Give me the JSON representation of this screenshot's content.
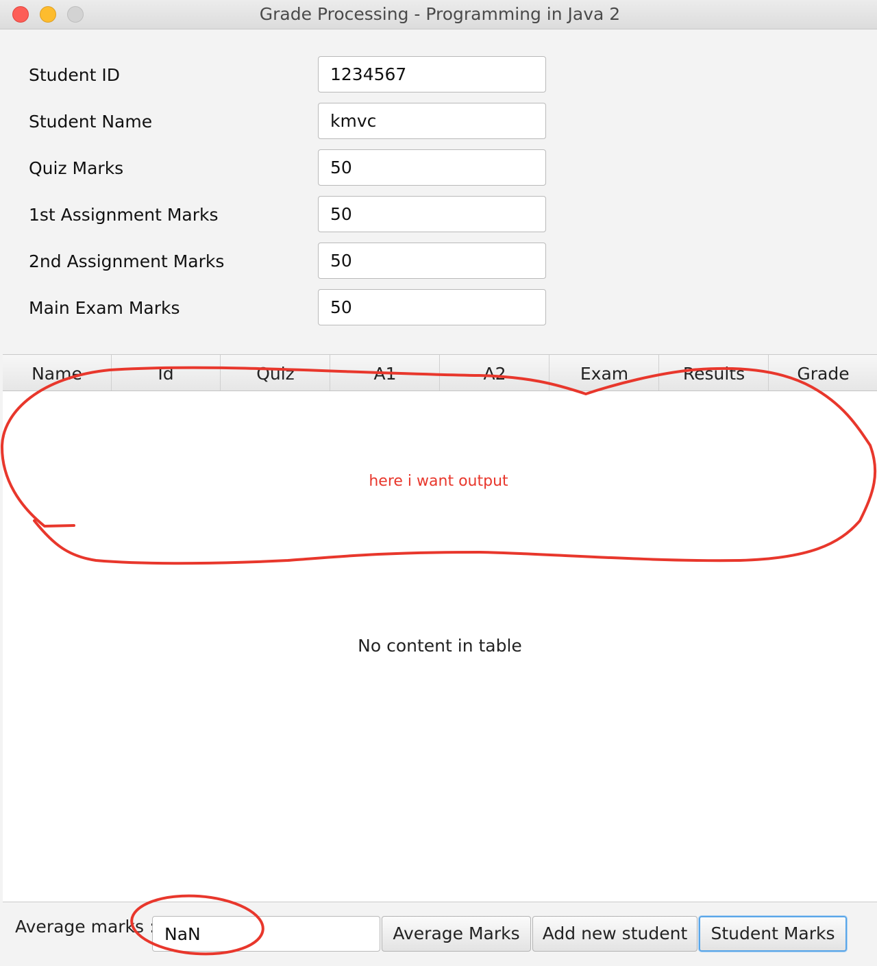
{
  "window": {
    "title": "Grade Processing - Programming in Java 2"
  },
  "form": {
    "fields": [
      {
        "label": "Student ID",
        "value": "1234567"
      },
      {
        "label": "Student Name",
        "value": "kmvc"
      },
      {
        "label": "Quiz Marks",
        "value": "50"
      },
      {
        "label": "1st Assignment Marks",
        "value": "50"
      },
      {
        "label": "2nd Assignment Marks",
        "value": "50"
      },
      {
        "label": "Main Exam Marks",
        "value": "50"
      }
    ]
  },
  "table": {
    "columns": [
      "Name",
      "Id",
      "Quiz",
      "A1",
      "A2",
      "Exam",
      "Results",
      "Grade"
    ],
    "placeholder": "No content in table"
  },
  "annotation": {
    "text": "here i want output",
    "color": "#e8372c"
  },
  "footer": {
    "average_label": "Average marks :",
    "average_value": "NaN",
    "buttons": {
      "average_marks": "Average Marks",
      "add_new_student": "Add new student",
      "student_marks": "Student Marks"
    }
  }
}
